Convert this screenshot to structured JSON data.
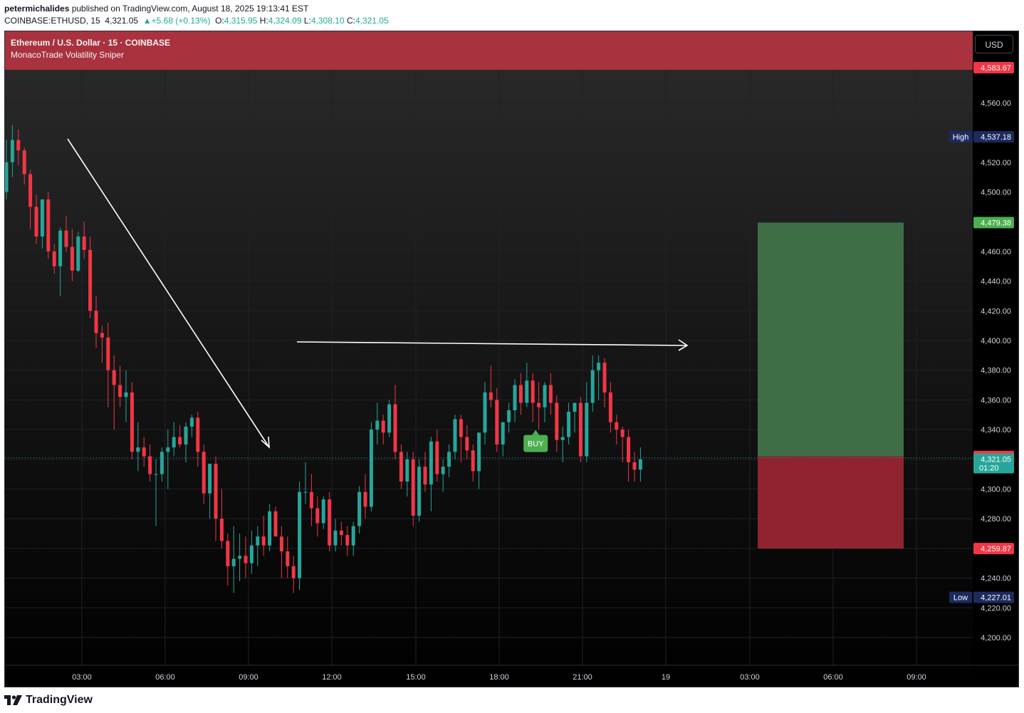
{
  "header": {
    "author": "petermichalides",
    "published_text": " published on TradingView.com, August 18, 2025 19:13:41 EST",
    "symbol": "COINBASE:ETHUSD, 15",
    "last": "4,321.05",
    "change_arrow": "▲",
    "change": "+5.68 (+0.13%)",
    "o_label": "O:",
    "o_value": "4,315.95",
    "h_label": "H:",
    "h_value": "4,324.09",
    "l_label": "L:",
    "l_value": "4,308.10",
    "c_label": "C:",
    "c_value": "4,321.05"
  },
  "banner": {
    "title": "Ethereum / U.S. Dollar · 15 · COINBASE",
    "indicator": "MonacoTrade Volatility Sniper"
  },
  "currency_button": "USD",
  "footer": {
    "brand": "TradingView"
  },
  "colors": {
    "bull": "#26a69a",
    "bear": "#f23645",
    "banner": "#b03340",
    "profit_zone": "#3f6e46",
    "loss_zone": "#8f2430",
    "buy_label": "#4caf50",
    "axis_text": "#d1d4dc",
    "hilo_badge": "#1c2a5e"
  },
  "chart_data": {
    "type": "candlestick",
    "symbol": "ETHUSD",
    "interval": "15",
    "ylim": [
      4180,
      4600
    ],
    "y_ticks": [
      "4,200.00",
      "4,220.00",
      "4,240.00",
      "4,280.00",
      "4,300.00",
      "4,340.00",
      "4,360.00",
      "4,380.00",
      "4,400.00",
      "4,420.00",
      "4,440.00",
      "4,460.00",
      "4,500.00",
      "4,520.00",
      "4,560.00"
    ],
    "x_ticks": [
      "03:00",
      "06:00",
      "09:00",
      "12:00",
      "15:00",
      "18:00",
      "21:00",
      "19",
      "03:00",
      "06:00",
      "09:00"
    ],
    "candles": [
      [
        4500,
        4535,
        4495,
        4520
      ],
      [
        4520,
        4545,
        4510,
        4535
      ],
      [
        4535,
        4542,
        4518,
        4528
      ],
      [
        4528,
        4530,
        4505,
        4512
      ],
      [
        4512,
        4515,
        4475,
        4490
      ],
      [
        4490,
        4498,
        4465,
        4470
      ],
      [
        4470,
        4495,
        4462,
        4495
      ],
      [
        4495,
        4500,
        4455,
        4460
      ],
      [
        4460,
        4465,
        4445,
        4450
      ],
      [
        4450,
        4476,
        4430,
        4474
      ],
      [
        4474,
        4484,
        4460,
        4463
      ],
      [
        4463,
        4475,
        4440,
        4447
      ],
      [
        4447,
        4473,
        4446,
        4470
      ],
      [
        4470,
        4480,
        4455,
        4461
      ],
      [
        4461,
        4470,
        4415,
        4420
      ],
      [
        4420,
        4430,
        4395,
        4405
      ],
      [
        4405,
        4410,
        4385,
        4402
      ],
      [
        4402,
        4412,
        4355,
        4380
      ],
      [
        4380,
        4390,
        4340,
        4370
      ],
      [
        4370,
        4383,
        4355,
        4362
      ],
      [
        4362,
        4380,
        4345,
        4365
      ],
      [
        4365,
        4372,
        4320,
        4325
      ],
      [
        4325,
        4345,
        4312,
        4328
      ],
      [
        4328,
        4335,
        4315,
        4322
      ],
      [
        4322,
        4330,
        4305,
        4310
      ],
      [
        4310,
        4320,
        4275,
        4310
      ],
      [
        4310,
        4328,
        4305,
        4325
      ],
      [
        4325,
        4340,
        4300,
        4328
      ],
      [
        4328,
        4345,
        4322,
        4335
      ],
      [
        4335,
        4343,
        4328,
        4330
      ],
      [
        4330,
        4345,
        4318,
        4342
      ],
      [
        4342,
        4350,
        4335,
        4348
      ],
      [
        4348,
        4352,
        4315,
        4325
      ],
      [
        4325,
        4330,
        4290,
        4297
      ],
      [
        4297,
        4310,
        4280,
        4317
      ],
      [
        4317,
        4322,
        4265,
        4280
      ],
      [
        4280,
        4300,
        4260,
        4265
      ],
      [
        4265,
        4270,
        4235,
        4248
      ],
      [
        4248,
        4275,
        4230,
        4253
      ],
      [
        4253,
        4270,
        4238,
        4255
      ],
      [
        4255,
        4268,
        4240,
        4250
      ],
      [
        4250,
        4272,
        4243,
        4262
      ],
      [
        4262,
        4275,
        4248,
        4268
      ],
      [
        4268,
        4282,
        4255,
        4262
      ],
      [
        4262,
        4290,
        4258,
        4285
      ],
      [
        4285,
        4288,
        4270,
        4268
      ],
      [
        4268,
        4275,
        4240,
        4258
      ],
      [
        4258,
        4268,
        4240,
        4248
      ],
      [
        4248,
        4255,
        4230,
        4240
      ],
      [
        4240,
        4305,
        4232,
        4298
      ],
      [
        4298,
        4318,
        4290,
        4298
      ],
      [
        4298,
        4310,
        4275,
        4287
      ],
      [
        4287,
        4295,
        4268,
        4277
      ],
      [
        4277,
        4295,
        4273,
        4293
      ],
      [
        4293,
        4298,
        4258,
        4262
      ],
      [
        4262,
        4280,
        4258,
        4272
      ],
      [
        4272,
        4278,
        4262,
        4269
      ],
      [
        4269,
        4275,
        4255,
        4262
      ],
      [
        4262,
        4278,
        4255,
        4275
      ],
      [
        4275,
        4302,
        4270,
        4298
      ],
      [
        4298,
        4310,
        4280,
        4288
      ],
      [
        4288,
        4345,
        4285,
        4340
      ],
      [
        4340,
        4358,
        4330,
        4346
      ],
      [
        4346,
        4350,
        4330,
        4338
      ],
      [
        4338,
        4360,
        4335,
        4357
      ],
      [
        4357,
        4370,
        4320,
        4325
      ],
      [
        4325,
        4330,
        4300,
        4305
      ],
      [
        4305,
        4325,
        4295,
        4320
      ],
      [
        4320,
        4325,
        4275,
        4282
      ],
      [
        4282,
        4320,
        4278,
        4315
      ],
      [
        4315,
        4325,
        4298,
        4303
      ],
      [
        4303,
        4335,
        4285,
        4332
      ],
      [
        4332,
        4340,
        4305,
        4310
      ],
      [
        4310,
        4320,
        4298,
        4315
      ],
      [
        4315,
        4330,
        4308,
        4325
      ],
      [
        4325,
        4350,
        4320,
        4347
      ],
      [
        4347,
        4350,
        4318,
        4335
      ],
      [
        4335,
        4343,
        4320,
        4326
      ],
      [
        4326,
        4330,
        4305,
        4312
      ],
      [
        4312,
        4338,
        4300,
        4338
      ],
      [
        4338,
        4372,
        4330,
        4365
      ],
      [
        4365,
        4383,
        4355,
        4360
      ],
      [
        4360,
        4368,
        4325,
        4330
      ],
      [
        4330,
        4345,
        4322,
        4345
      ],
      [
        4345,
        4358,
        4338,
        4353
      ],
      [
        4353,
        4374,
        4345,
        4370
      ],
      [
        4370,
        4378,
        4350,
        4358
      ],
      [
        4358,
        4385,
        4355,
        4373
      ],
      [
        4373,
        4378,
        4345,
        4358
      ],
      [
        4358,
        4372,
        4340,
        4355
      ],
      [
        4355,
        4372,
        4345,
        4370
      ],
      [
        4370,
        4378,
        4350,
        4358
      ],
      [
        4358,
        4363,
        4325,
        4333
      ],
      [
        4333,
        4342,
        4318,
        4335
      ],
      [
        4335,
        4358,
        4330,
        4352
      ],
      [
        4352,
        4358,
        4338,
        4358
      ],
      [
        4358,
        4362,
        4318,
        4322
      ],
      [
        4322,
        4372,
        4318,
        4358
      ],
      [
        4358,
        4390,
        4352,
        4380
      ],
      [
        4380,
        4390,
        4360,
        4385
      ],
      [
        4385,
        4388,
        4355,
        4365
      ],
      [
        4365,
        4372,
        4338,
        4345
      ],
      [
        4345,
        4350,
        4330,
        4340
      ],
      [
        4340,
        4342,
        4318,
        4335
      ],
      [
        4335,
        4340,
        4305,
        4318
      ],
      [
        4318,
        4325,
        4305,
        4313
      ],
      [
        4313,
        4328,
        4305,
        4320
      ]
    ],
    "price_labels": {
      "target": "4,583.67",
      "take_profit": "4,479.38",
      "entry": "4,321.90",
      "last": "4,321.05",
      "countdown": "01:20",
      "stop_loss": "4,259.87",
      "high_label": "High",
      "high_value": "4,537.18",
      "low_label": "Low",
      "low_value": "4,227.01"
    },
    "signal": "BUY",
    "position": {
      "type": "long",
      "entry": 4321.9,
      "target": 4479.38,
      "stop": 4259.87
    }
  }
}
